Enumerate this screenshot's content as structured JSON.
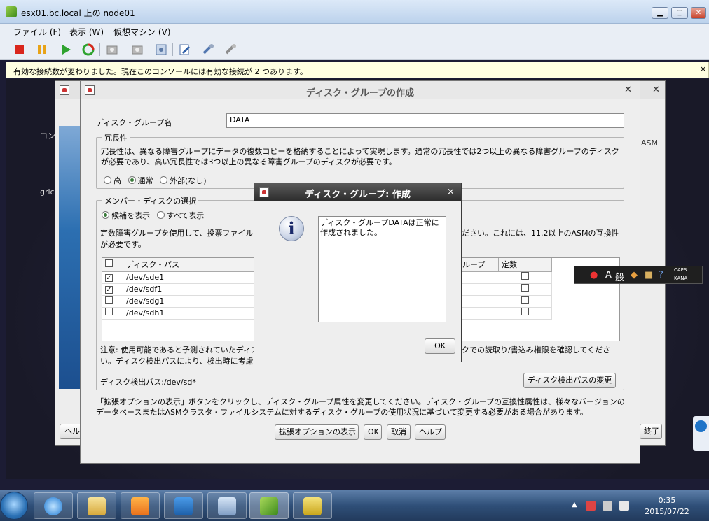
{
  "outer_window": {
    "title": "esx01.bc.local 上の node01",
    "menu": [
      "ファイル (F)",
      "表示 (W)",
      "仮想マシン (V)"
    ],
    "notice": "有効な接続数が変わりました。現在このコンソールには有効な接続が 2 つあります。"
  },
  "background": {
    "text_left_1": "コン",
    "text_left_2": "gric",
    "text_right": "ASM",
    "help_btn": "ヘル",
    "exit_btn": "終了"
  },
  "dialog": {
    "title": "ディスク・グループの作成",
    "group_name_label": "ディスク・グループ名",
    "group_name_value": "DATA",
    "redundancy": {
      "legend": "冗長性",
      "description": "冗長性は、異なる障害グループにデータの複数コピーを格納することによって実現します。通常の冗長性では2つ以上の異なる障害グループのディスクが必要であり、高い冗長性では3つ以上の異なる障害グループのディスクが必要です。",
      "options": [
        "高",
        "通常",
        "外部(なし)"
      ],
      "selected": "通常"
    },
    "member": {
      "legend": "メンバー・ディスクの選択",
      "options": [
        "候補を表示",
        "すべて表示"
      ],
      "selected": "候補を表示",
      "desc_left": "定数障害グループを使用して、投票ファイル",
      "desc_right": "ださい。これには、11.2以上のASMの互換性",
      "desc_line2": "が必要です。"
    },
    "table": {
      "col_path": "ディスク・パス",
      "col_group": "ループ",
      "col_quorum": "定数",
      "rows": [
        {
          "path": "/dev/sde1",
          "checked": true
        },
        {
          "path": "/dev/sdf1",
          "checked": true
        },
        {
          "path": "/dev/sdg1",
          "checked": false
        },
        {
          "path": "/dev/sdh1",
          "checked": false
        }
      ]
    },
    "note_left": "注意: 使用可能であると予測されていたディス",
    "note_right": "クでの読取り/書込み権限を確認してくださ",
    "note_line2": "い。ディスク検出パスにより、検出時に考慮",
    "discovery_label": "ディスク検出パス:/dev/sd*",
    "discovery_button": "ディスク検出パスの変更",
    "bottom_text": "「拡張オプションの表示」ボタンをクリックし、ディスク・グループ属性を変更してください。ディスク・グループの互換性属性は、様々なバージョンのデータベースまたはASMクラスタ・ファイルシステムに対するディスク・グループの使用状況に基づいて変更する必要がある場合があります。",
    "buttons": {
      "advanced": "拡張オプションの表示",
      "ok": "OK",
      "cancel": "取消",
      "help": "ヘルプ"
    }
  },
  "popup": {
    "title": "ディスク・グループ: 作成",
    "message": "ディスク・グループDATAは正常に作成されました。",
    "ok": "OK"
  },
  "ime": {
    "mode": "A",
    "kanji": "般",
    "caps": "CAPS",
    "kana": "KANA"
  },
  "taskbar": {
    "time": "0:35",
    "date": "2015/07/22"
  }
}
